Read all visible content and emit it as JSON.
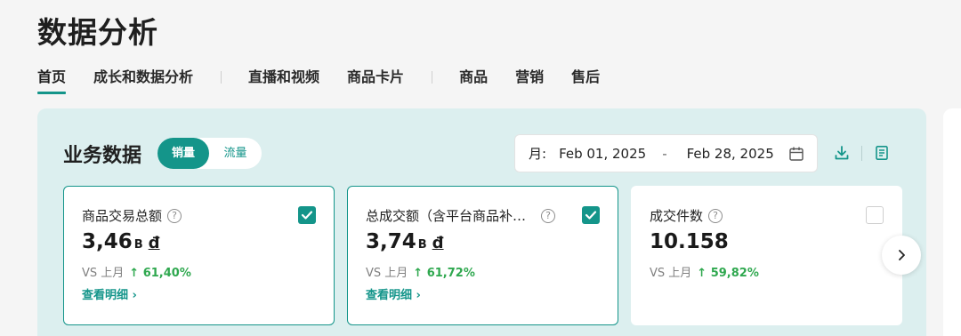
{
  "page": {
    "title": "数据分析"
  },
  "nav": {
    "tabs": [
      "首页",
      "成长和数据分析",
      "直播和视频",
      "商品卡片",
      "商品",
      "营销",
      "售后"
    ]
  },
  "business": {
    "title": "业务数据",
    "toggle": {
      "active": "销量",
      "inactive": "流量"
    },
    "date": {
      "label": "月:",
      "start": "Feb 01, 2025",
      "separator": "-",
      "end": "Feb 28, 2025"
    }
  },
  "cards": [
    {
      "title": "商品交易总额",
      "value": "3,46",
      "unit": "B",
      "currency": "đ",
      "vs_label": "VS 上月",
      "change": "61,40%",
      "detail": "查看明细 ›",
      "checked": true
    },
    {
      "title": "总成交额（含平台商品补…",
      "value": "3,74",
      "unit": "B",
      "currency": "đ",
      "vs_label": "VS 上月",
      "change": "61,72%",
      "detail": "查看明细 ›",
      "checked": true
    },
    {
      "title": "成交件数",
      "value": "10.158",
      "unit": "",
      "currency": "",
      "vs_label": "VS 上月",
      "change": "59,82%",
      "detail": "",
      "checked": false
    }
  ],
  "colors": {
    "accent": "#14958a",
    "positive": "#2fa84f",
    "panel_bg": "#dcefef"
  },
  "icons": [
    "calendar-icon",
    "download-icon",
    "report-icon",
    "help-icon",
    "check-icon",
    "arrow-up-icon",
    "chevron-right-icon"
  ]
}
